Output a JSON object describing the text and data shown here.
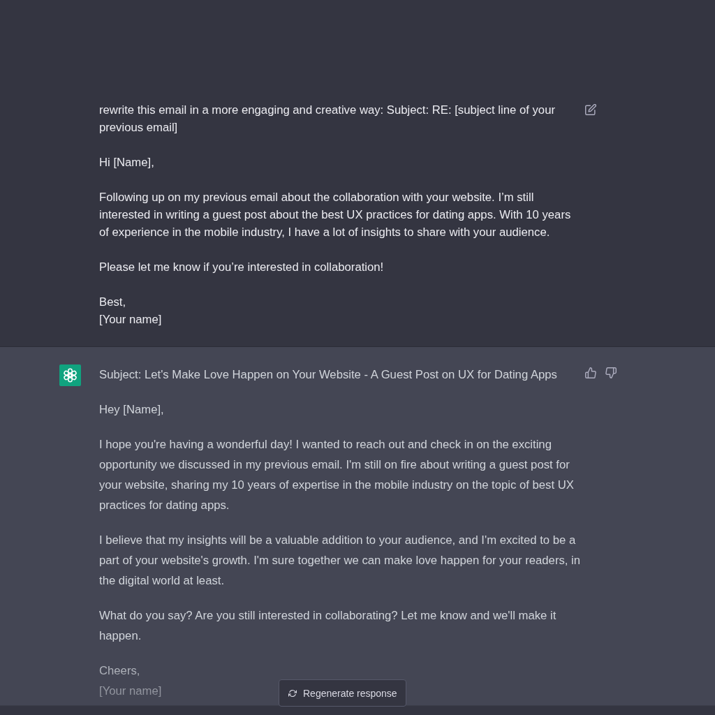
{
  "messages": [
    {
      "kind": "user",
      "paragraphs": [
        "rewrite this email in a more engaging and creative way: Subject: RE: [subject line of your previous email]",
        "Hi [Name],",
        "Following up on my previous email about the collaboration with your website. I’m still interested in writing a guest post about the best UX practices for dating apps. With 10 years of experience in the mobile industry, I have a lot of insights to share with your audience.",
        "Please let me know if you’re interested in collaboration!",
        "Best,\n[Your name]"
      ]
    },
    {
      "kind": "assistant",
      "paragraphs": [
        "Subject: Let's Make Love Happen on Your Website - A Guest Post on UX for Dating Apps",
        "Hey [Name],",
        "I hope you're having a wonderful day! I wanted to reach out and check in on the exciting opportunity we discussed in my previous email. I'm still on fire about writing a guest post for your website, sharing my 10 years of expertise in the mobile industry on the topic of best UX practices for dating apps.",
        "I believe that my insights will be a valuable addition to your audience, and I'm excited to be a part of your website's growth. I'm sure together we can make love happen for your readers, in the digital world at least.",
        "What do you say? Are you still interested in collaborating? Let me know and we'll make it happen.",
        "Cheers,\n[Your name]"
      ]
    }
  ],
  "regenerate_button": {
    "label": "Regenerate response"
  }
}
